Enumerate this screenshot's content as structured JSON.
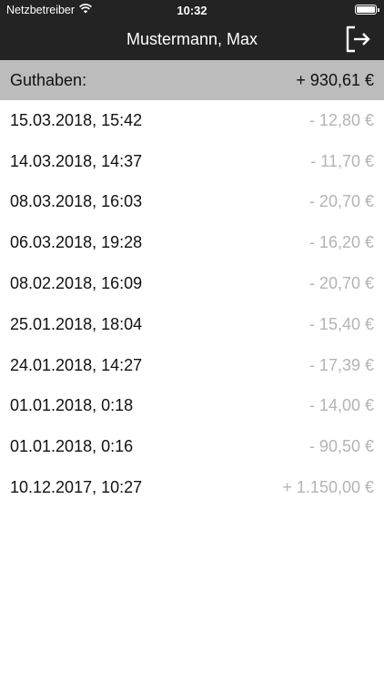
{
  "status_bar": {
    "carrier": "Netzbetreiber",
    "time": "10:32",
    "wifi_icon": "wifi-icon",
    "battery_icon": "battery-icon"
  },
  "nav": {
    "title": "Mustermann, Max",
    "logout_icon": "logout-icon"
  },
  "balance": {
    "label": "Guthaben:",
    "value": "+ 930,61 €"
  },
  "transactions": [
    {
      "date": "15.03.2018, 15:42",
      "amount": "- 12,80 €"
    },
    {
      "date": "14.03.2018, 14:37",
      "amount": "- 11,70 €"
    },
    {
      "date": "08.03.2018, 16:03",
      "amount": "- 20,70 €"
    },
    {
      "date": "06.03.2018, 19:28",
      "amount": "- 16,20 €"
    },
    {
      "date": "08.02.2018, 16:09",
      "amount": "- 20,70 €"
    },
    {
      "date": "25.01.2018, 18:04",
      "amount": "- 15,40 €"
    },
    {
      "date": "24.01.2018, 14:27",
      "amount": "- 17,39 €"
    },
    {
      "date": "01.01.2018, 0:18",
      "amount": "- 14,00 €"
    },
    {
      "date": "01.01.2018, 0:16",
      "amount": "- 90,50 €"
    },
    {
      "date": "10.12.2017, 10:27",
      "amount": "+ 1.150,00 €"
    }
  ],
  "colors": {
    "header_bg": "#232323",
    "balance_bg": "#bcbcbc",
    "amount_text": "#b4b4b4"
  }
}
